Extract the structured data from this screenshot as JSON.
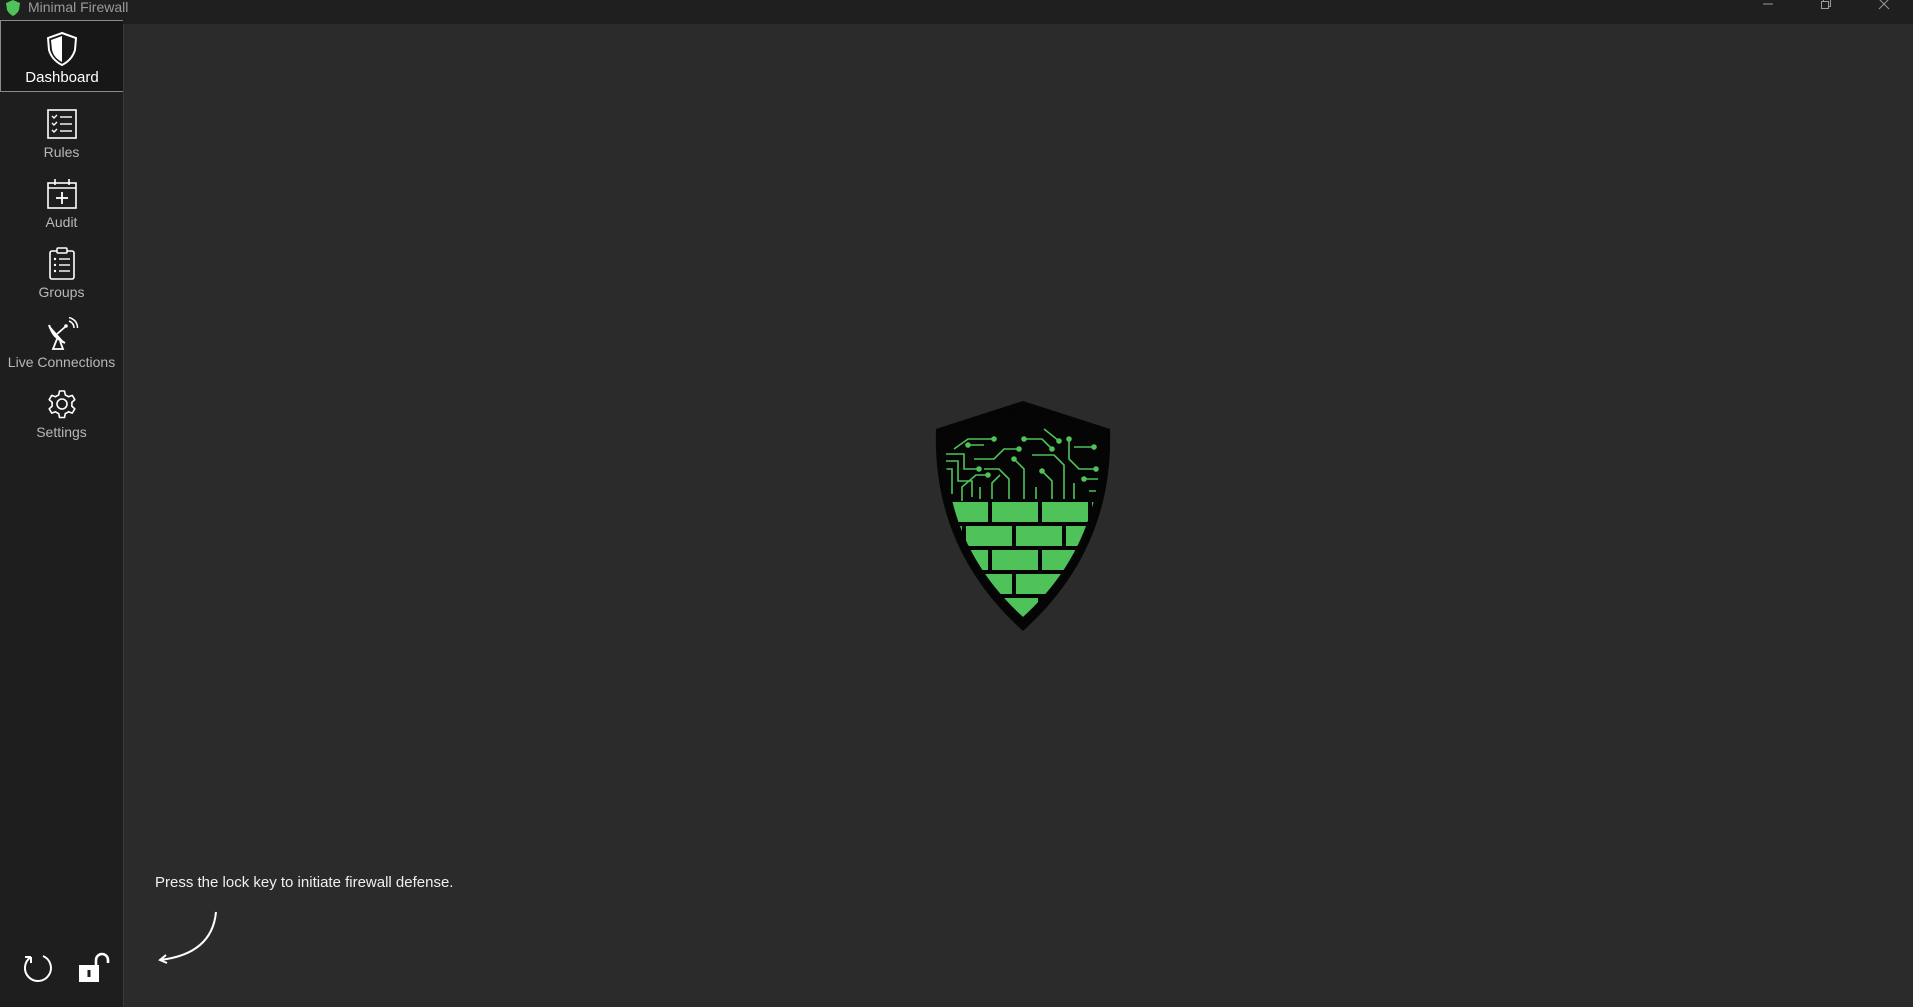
{
  "window": {
    "title": "Minimal Firewall",
    "controls": [
      "minimize-icon",
      "restore-icon",
      "close-icon"
    ]
  },
  "sidebar": {
    "items": [
      {
        "label": "Dashboard",
        "icon": "shield-icon",
        "active": true
      },
      {
        "label": "Rules",
        "icon": "checklist-icon",
        "active": false
      },
      {
        "label": "Audit",
        "icon": "calendar-add-icon",
        "active": false
      },
      {
        "label": "Groups",
        "icon": "clipboard-list-icon",
        "active": false
      },
      {
        "label": "Live Connections",
        "icon": "satellite-dish-icon",
        "active": false
      },
      {
        "label": "Settings",
        "icon": "gear-icon",
        "active": false
      }
    ],
    "bottom": [
      "refresh-icon",
      "unlock-icon"
    ]
  },
  "main": {
    "hint": "Press the lock key to initiate firewall defense."
  },
  "colors": {
    "accent_green": "#4fc25a",
    "background": "#2b2b2b",
    "sidebar": "#1e1e1e"
  }
}
